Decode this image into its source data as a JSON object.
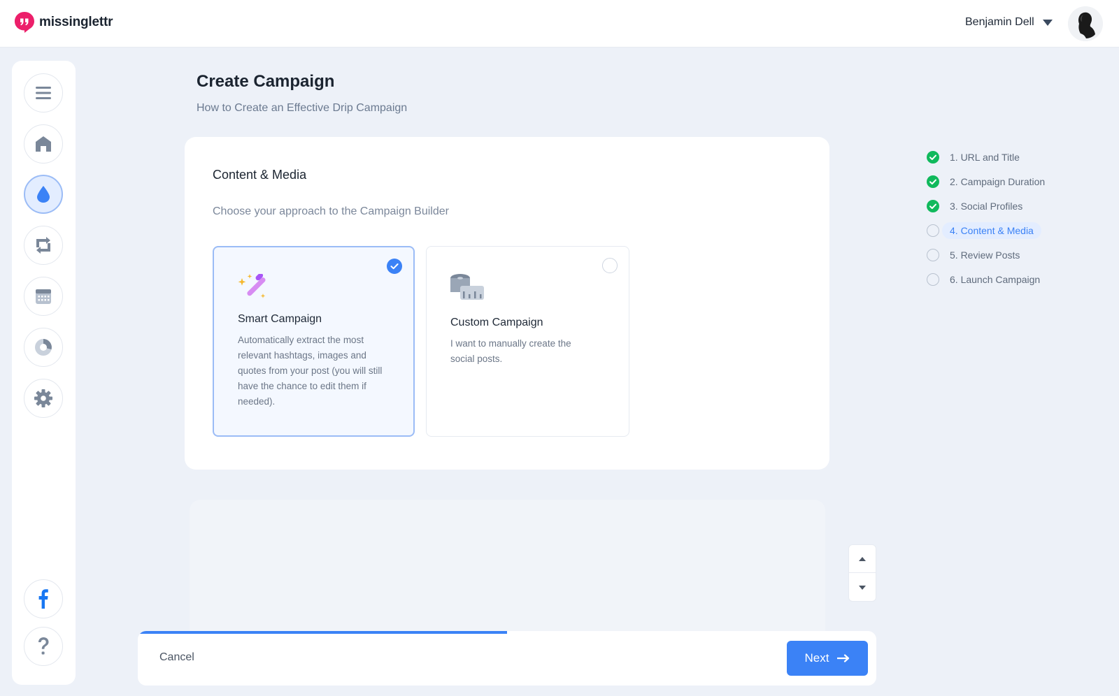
{
  "header": {
    "logo_text": "missinglettr",
    "user_name": "Benjamin Dell"
  },
  "sidebar": {
    "items": [
      {
        "name": "menu",
        "icon": "hamburger-icon",
        "active": false
      },
      {
        "name": "home",
        "icon": "home-icon",
        "active": false
      },
      {
        "name": "drip",
        "icon": "drop-icon",
        "active": true
      },
      {
        "name": "repeat",
        "icon": "repeat-icon",
        "active": false
      },
      {
        "name": "calendar",
        "icon": "calendar-icon",
        "active": false
      },
      {
        "name": "analytics",
        "icon": "pie-chart-icon",
        "active": false
      },
      {
        "name": "settings",
        "icon": "gear-icon",
        "active": false
      },
      {
        "name": "facebook",
        "icon": "facebook-icon",
        "active": false
      },
      {
        "name": "help",
        "icon": "question-icon",
        "active": false
      }
    ]
  },
  "page": {
    "title": "Create Campaign",
    "subtitle": "How to Create an Effective Drip Campaign"
  },
  "card": {
    "title": "Content & Media",
    "description": "Choose your approach to the Campaign Builder",
    "options": [
      {
        "title": "Smart Campaign",
        "text": "Automatically extract the most relevant hashtags, images and quotes from your post (you will still have the chance to edit them if needed).",
        "selected": true,
        "icon": "magic-wand-icon"
      },
      {
        "title": "Custom Campaign",
        "text": "I want to manually create the social posts.",
        "selected": false,
        "icon": "measuring-tape-icon"
      }
    ]
  },
  "steps": [
    {
      "label": "1. URL and Title",
      "status": "done"
    },
    {
      "label": "2. Campaign Duration",
      "status": "done"
    },
    {
      "label": "3. Social Profiles",
      "status": "done"
    },
    {
      "label": "4. Content & Media",
      "status": "current"
    },
    {
      "label": "5. Review Posts",
      "status": "todo"
    },
    {
      "label": "6. Launch Campaign",
      "status": "todo"
    }
  ],
  "footer": {
    "cancel_label": "Cancel",
    "next_label": "Next",
    "progress_percent": 50
  },
  "colors": {
    "accent": "#3b82f6",
    "success": "#10b95c",
    "brand": "#ec1f6a"
  }
}
